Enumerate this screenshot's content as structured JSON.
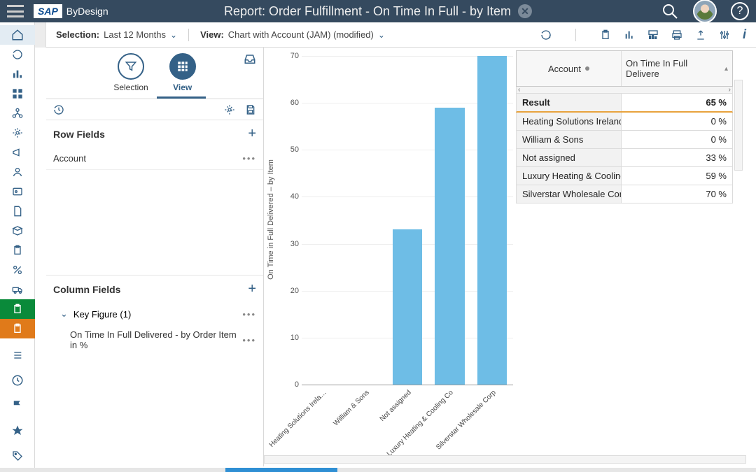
{
  "header": {
    "brand_sap": "SAP",
    "brand_byd": "ByDesign",
    "title": "Report: Order Fulfillment - On Time In Full - by Item",
    "help": "?"
  },
  "toolbar": {
    "selection_label": "Selection:",
    "selection_value": "Last 12 Months",
    "view_label": "View:",
    "view_value": "Chart with Account (JAM) (modified)"
  },
  "config": {
    "mode_selection": "Selection",
    "mode_view": "View",
    "row_fields_title": "Row Fields",
    "row_field_1": "Account",
    "column_fields_title": "Column Fields",
    "key_figure_label": "Key Figure (1)",
    "sub_kf": "On Time In Full Delivered - by Order Item in %"
  },
  "table": {
    "col1": "Account",
    "col2": "On Time In Full Delivere",
    "rows": [
      {
        "name": "Result",
        "value": "65 %"
      },
      {
        "name": "Heating Solutions Ireland",
        "value": "0 %"
      },
      {
        "name": "William & Sons",
        "value": "0 %"
      },
      {
        "name": "Not assigned",
        "value": "33 %"
      },
      {
        "name": "Luxury Heating & Cooling Co",
        "value": "59 %"
      },
      {
        "name": "Silverstar Wholesale Corp",
        "value": "70 %"
      }
    ]
  },
  "chart_data": {
    "type": "bar",
    "title": "",
    "ylabel": "On Time in Full Delivered – by Item",
    "xlabel": "",
    "ylim": [
      0,
      70
    ],
    "ticks": [
      0,
      10,
      20,
      30,
      40,
      50,
      60,
      70
    ],
    "categories": [
      "Heating Solutions Irela…",
      "William & Sons",
      "Not assigned",
      "Luxury Heating & Cooling Co",
      "Silverstar Wholesale Corp"
    ],
    "values": [
      0,
      0,
      33,
      59,
      70
    ],
    "color": "#6ebde6"
  }
}
